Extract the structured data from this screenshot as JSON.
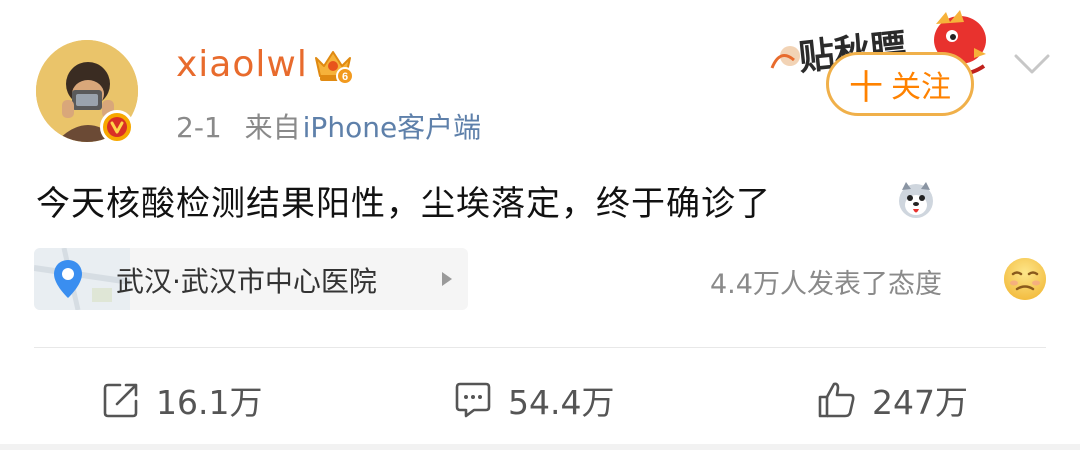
{
  "post": {
    "username": "xiaolwl",
    "date": "2-1",
    "source_prefix": "来自",
    "source": "iPhone客户端",
    "content": "今天核酸检测结果阳性，尘埃落定，终于确诊了",
    "location": "武汉·武汉市中心医院",
    "reactions_text": "4.4万人发表了态度"
  },
  "follow": {
    "label": "关注",
    "plus": "十"
  },
  "sticker": {
    "text": "贴秋膘"
  },
  "actions": {
    "repost": "16.1万",
    "comment": "54.4万",
    "like": "247万"
  },
  "colors": {
    "username": "#e86b2d",
    "follow_border": "#f0b04a",
    "follow_text": "#ff8200",
    "source": "#5e80aa",
    "meta": "#8a8a8a"
  }
}
